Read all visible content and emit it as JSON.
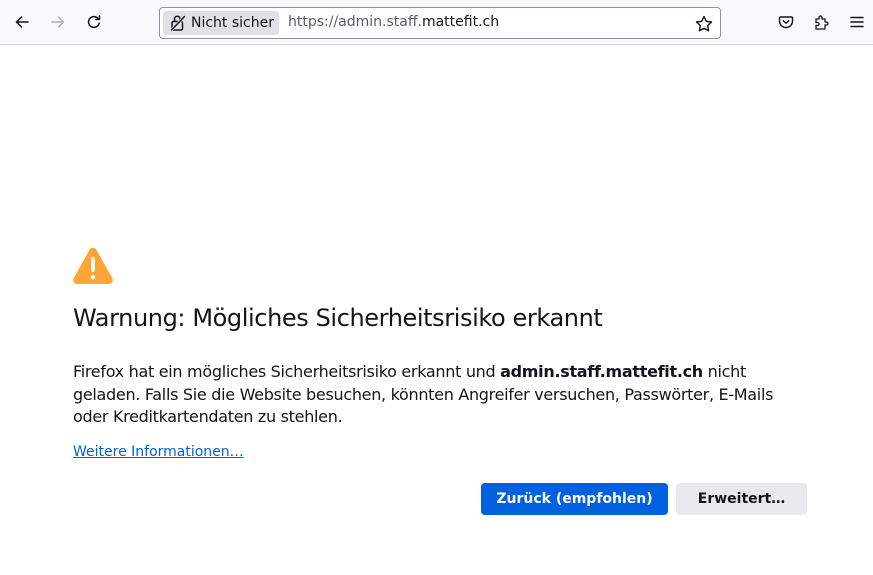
{
  "browser": {
    "identity_label": "Nicht sicher",
    "url_prefix": "https://admin.staff.",
    "url_host": "mattefit.ch"
  },
  "error_page": {
    "title": "Warnung: Mögliches Sicherheitsrisiko erkannt",
    "description_line1_start": "Firefox hat ein mögliches Sicherheitsrisiko erkannt und ",
    "description_domain": "admin.staff.mattefit.ch",
    "description_line1_end": " nicht",
    "description_line2": "geladen. Falls Sie die Website besuchen, könnten Angreifer versuchen, Passwörter, E-Mails",
    "description_line3": "oder Kreditkartendaten zu stehlen.",
    "learn_more": "Weitere Informationen…",
    "back_button": "Zurück (empfohlen)",
    "advanced_button": "Erweitert…"
  },
  "colors": {
    "accent": "#0061e0",
    "warning": "#ffa436"
  }
}
